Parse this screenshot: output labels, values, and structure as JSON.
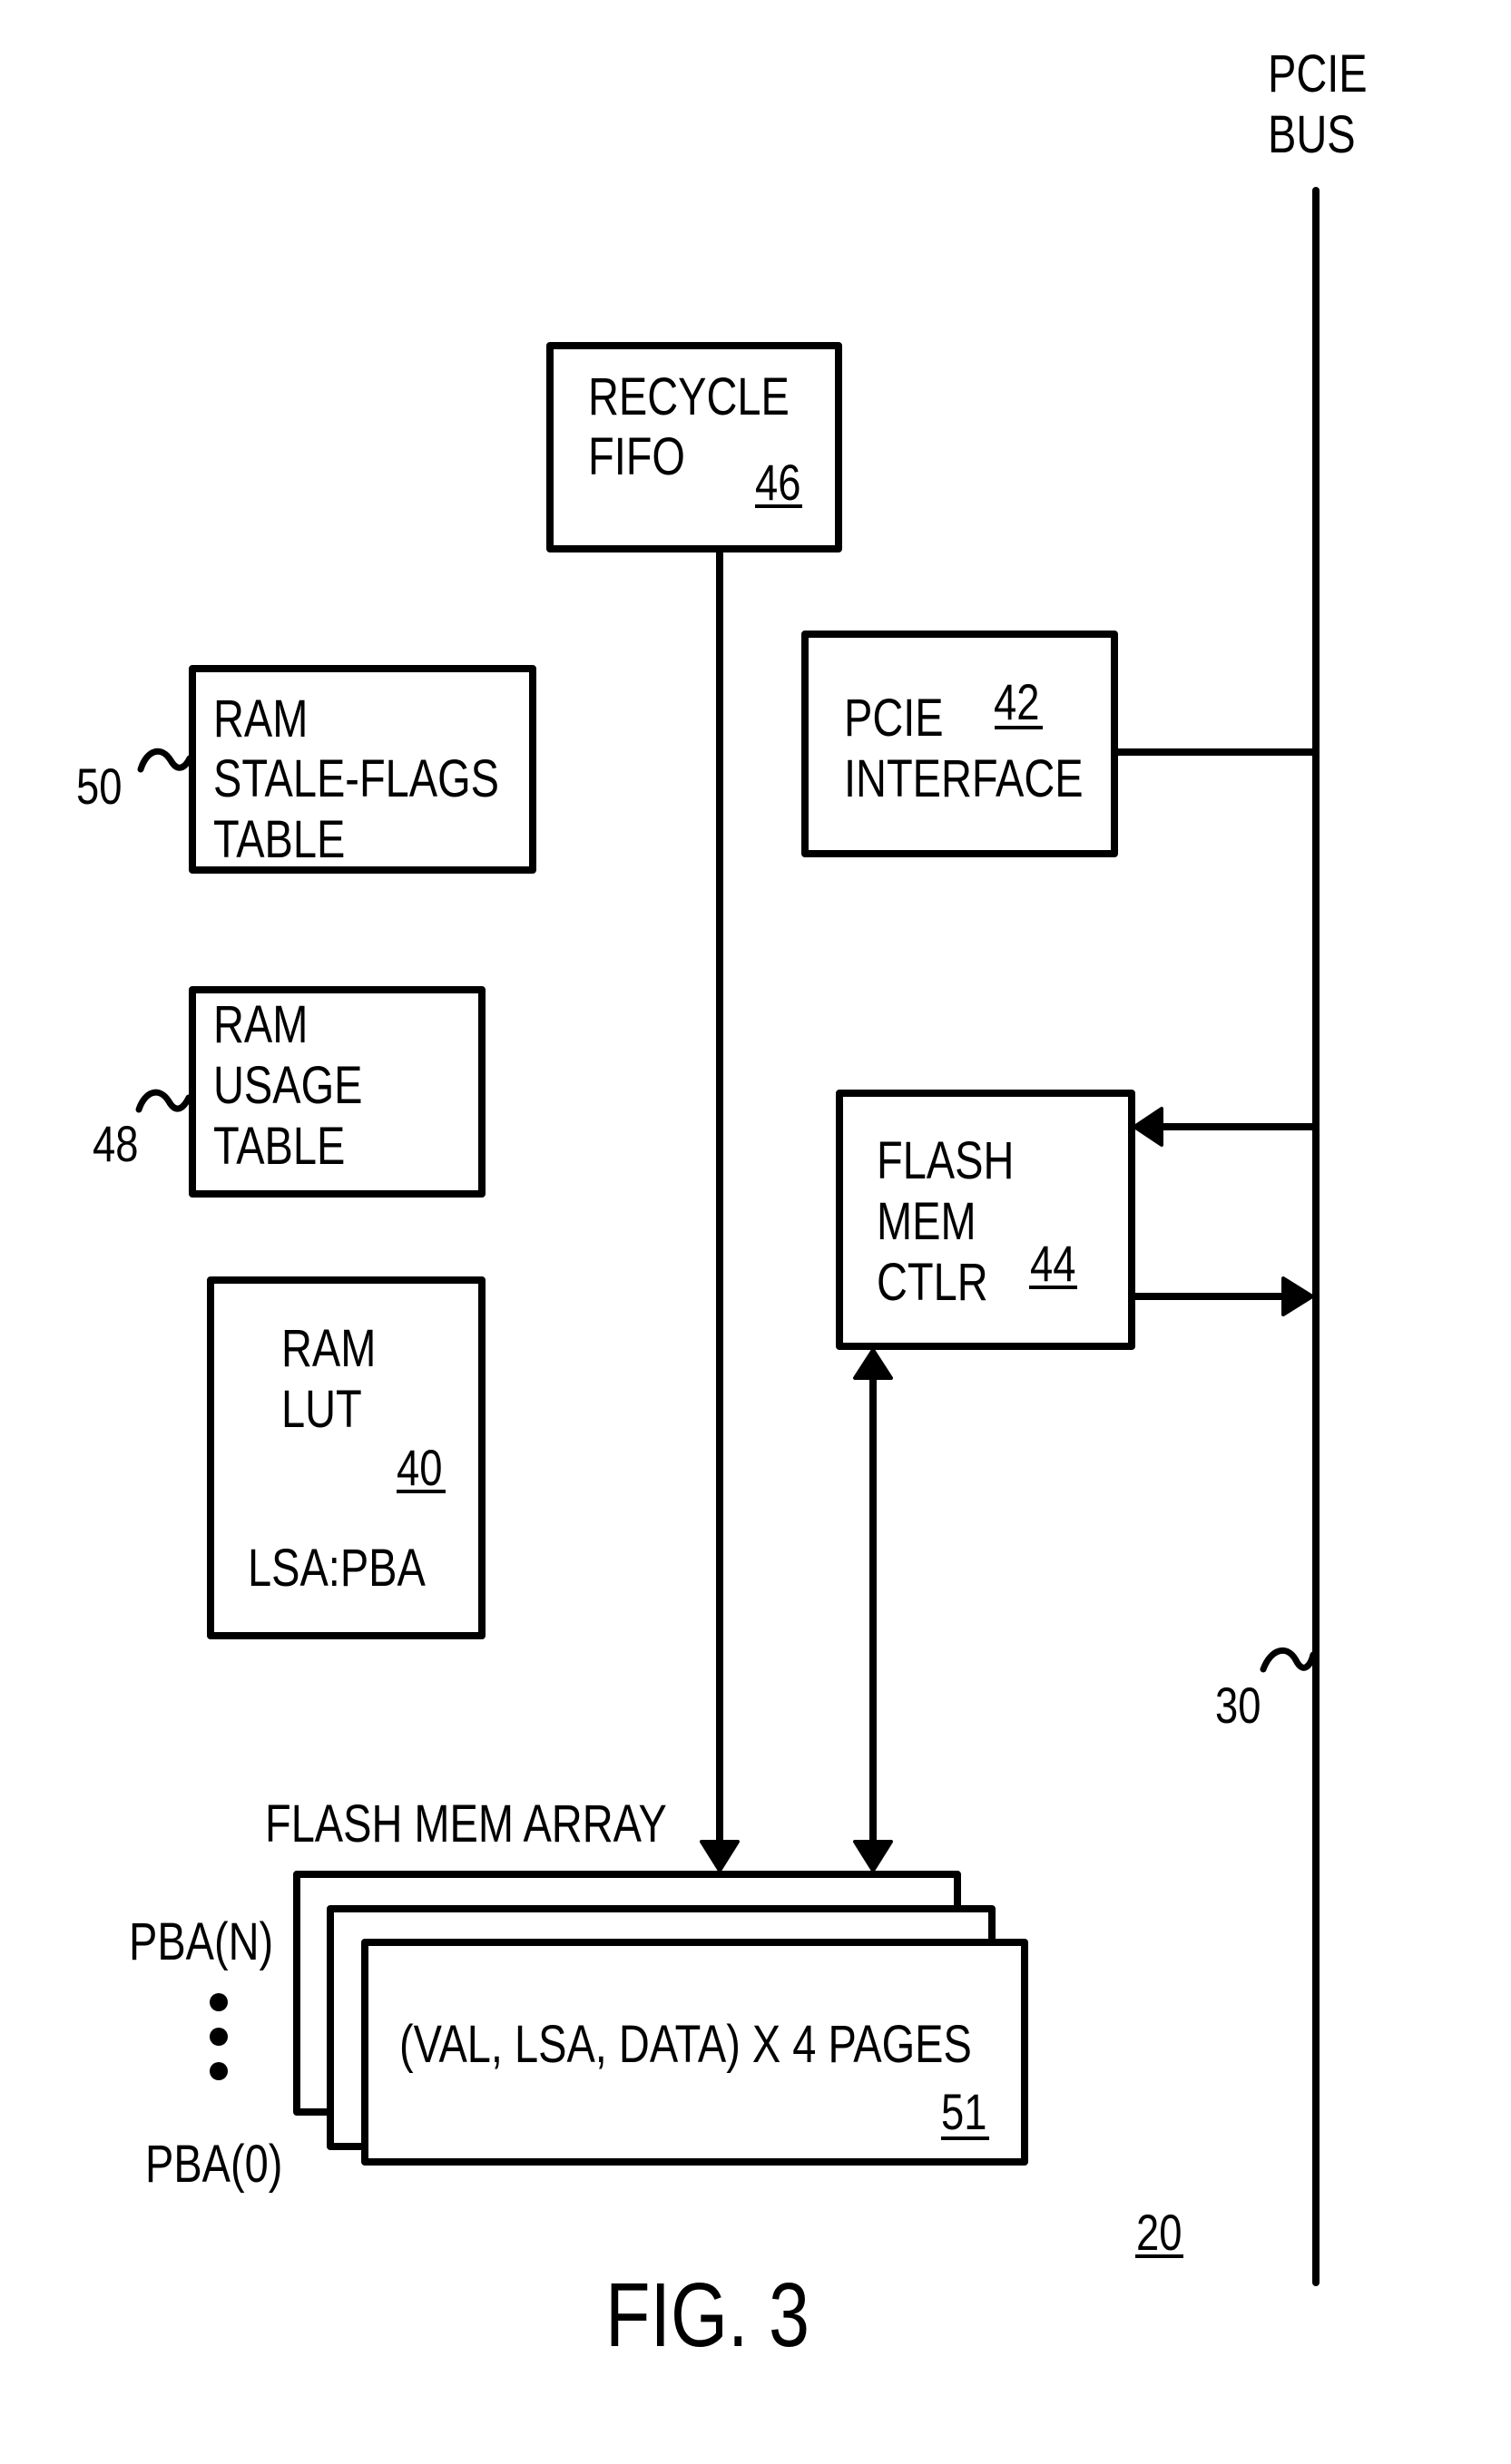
{
  "figure": {
    "title": "FIG. 3",
    "reference_numeral": "20"
  },
  "bus": {
    "label_line1": "PCIE",
    "label_line2": "BUS",
    "reference_numeral": "30"
  },
  "recycle_fifo": {
    "line1": "RECYCLE",
    "line2": "FIFO",
    "reference_numeral": "46"
  },
  "pcie_interface": {
    "line1": "PCIE",
    "line2": "INTERFACE",
    "reference_numeral": "42"
  },
  "flash_mem_ctlr": {
    "line1": "FLASH",
    "line2": "MEM",
    "line3": "CTLR",
    "reference_numeral": "44"
  },
  "stale_flags_table": {
    "line1": "RAM",
    "line2": "STALE-FLAGS",
    "line3": "TABLE",
    "reference_numeral": "50"
  },
  "usage_table": {
    "line1": "RAM",
    "line2": "USAGE",
    "line3": "TABLE",
    "reference_numeral": "48"
  },
  "ram_lut": {
    "line1": "RAM",
    "line2": "LUT",
    "reference_numeral": "40",
    "mapping": "LSA:PBA"
  },
  "flash_mem_array": {
    "title": "FLASH MEM ARRAY",
    "page_contents": "(VAL, LSA, DATA) X 4 PAGES",
    "reference_numeral": "51",
    "top_block_label": "PBA(N)",
    "bottom_block_label": "PBA(0)",
    "ellipsis_icon": "vertical-ellipsis"
  }
}
